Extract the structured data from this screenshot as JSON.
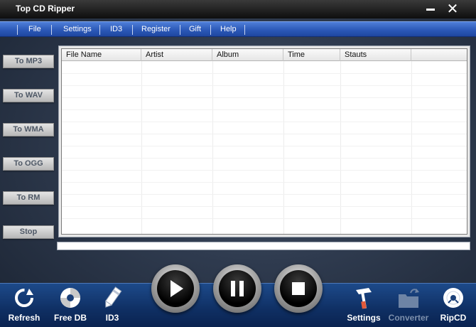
{
  "window": {
    "title": "Top CD Ripper",
    "minimize_icon": "minimize-icon",
    "close_icon": "close-icon"
  },
  "menu": {
    "items": [
      {
        "label": "File"
      },
      {
        "label": "Settings"
      },
      {
        "label": "ID3"
      },
      {
        "label": "Register"
      },
      {
        "label": "Gift"
      },
      {
        "label": "Help"
      }
    ]
  },
  "sidebar": {
    "buttons": [
      {
        "label": "To MP3"
      },
      {
        "label": "To WAV"
      },
      {
        "label": "To WMA"
      },
      {
        "label": "To OGG"
      },
      {
        "label": "To RM"
      },
      {
        "label": "Stop"
      }
    ]
  },
  "table": {
    "columns": [
      {
        "label": "File Name"
      },
      {
        "label": "Artist"
      },
      {
        "label": "Album"
      },
      {
        "label": "Time"
      },
      {
        "label": "Stauts"
      }
    ],
    "rows": []
  },
  "player": {
    "play_icon": "play-icon",
    "pause_icon": "pause-icon",
    "stop_icon": "stop-icon"
  },
  "toolbar": {
    "left": [
      {
        "label": "Refresh",
        "icon": "refresh-icon"
      },
      {
        "label": "Free DB",
        "icon": "free-db-icon"
      },
      {
        "label": "ID3",
        "icon": "id3-pencil-icon"
      }
    ],
    "right": [
      {
        "label": "Settings",
        "icon": "settings-hammer-icon",
        "enabled": true
      },
      {
        "label": "Converter",
        "icon": "converter-folder-icon",
        "enabled": false
      },
      {
        "label": "RipCD",
        "icon": "rip-cd-icon",
        "enabled": true
      }
    ]
  },
  "colors": {
    "menu_bar": "#2c59b8",
    "bottom_bar": "#0f2f63",
    "side_button_text": "#4e5866"
  }
}
